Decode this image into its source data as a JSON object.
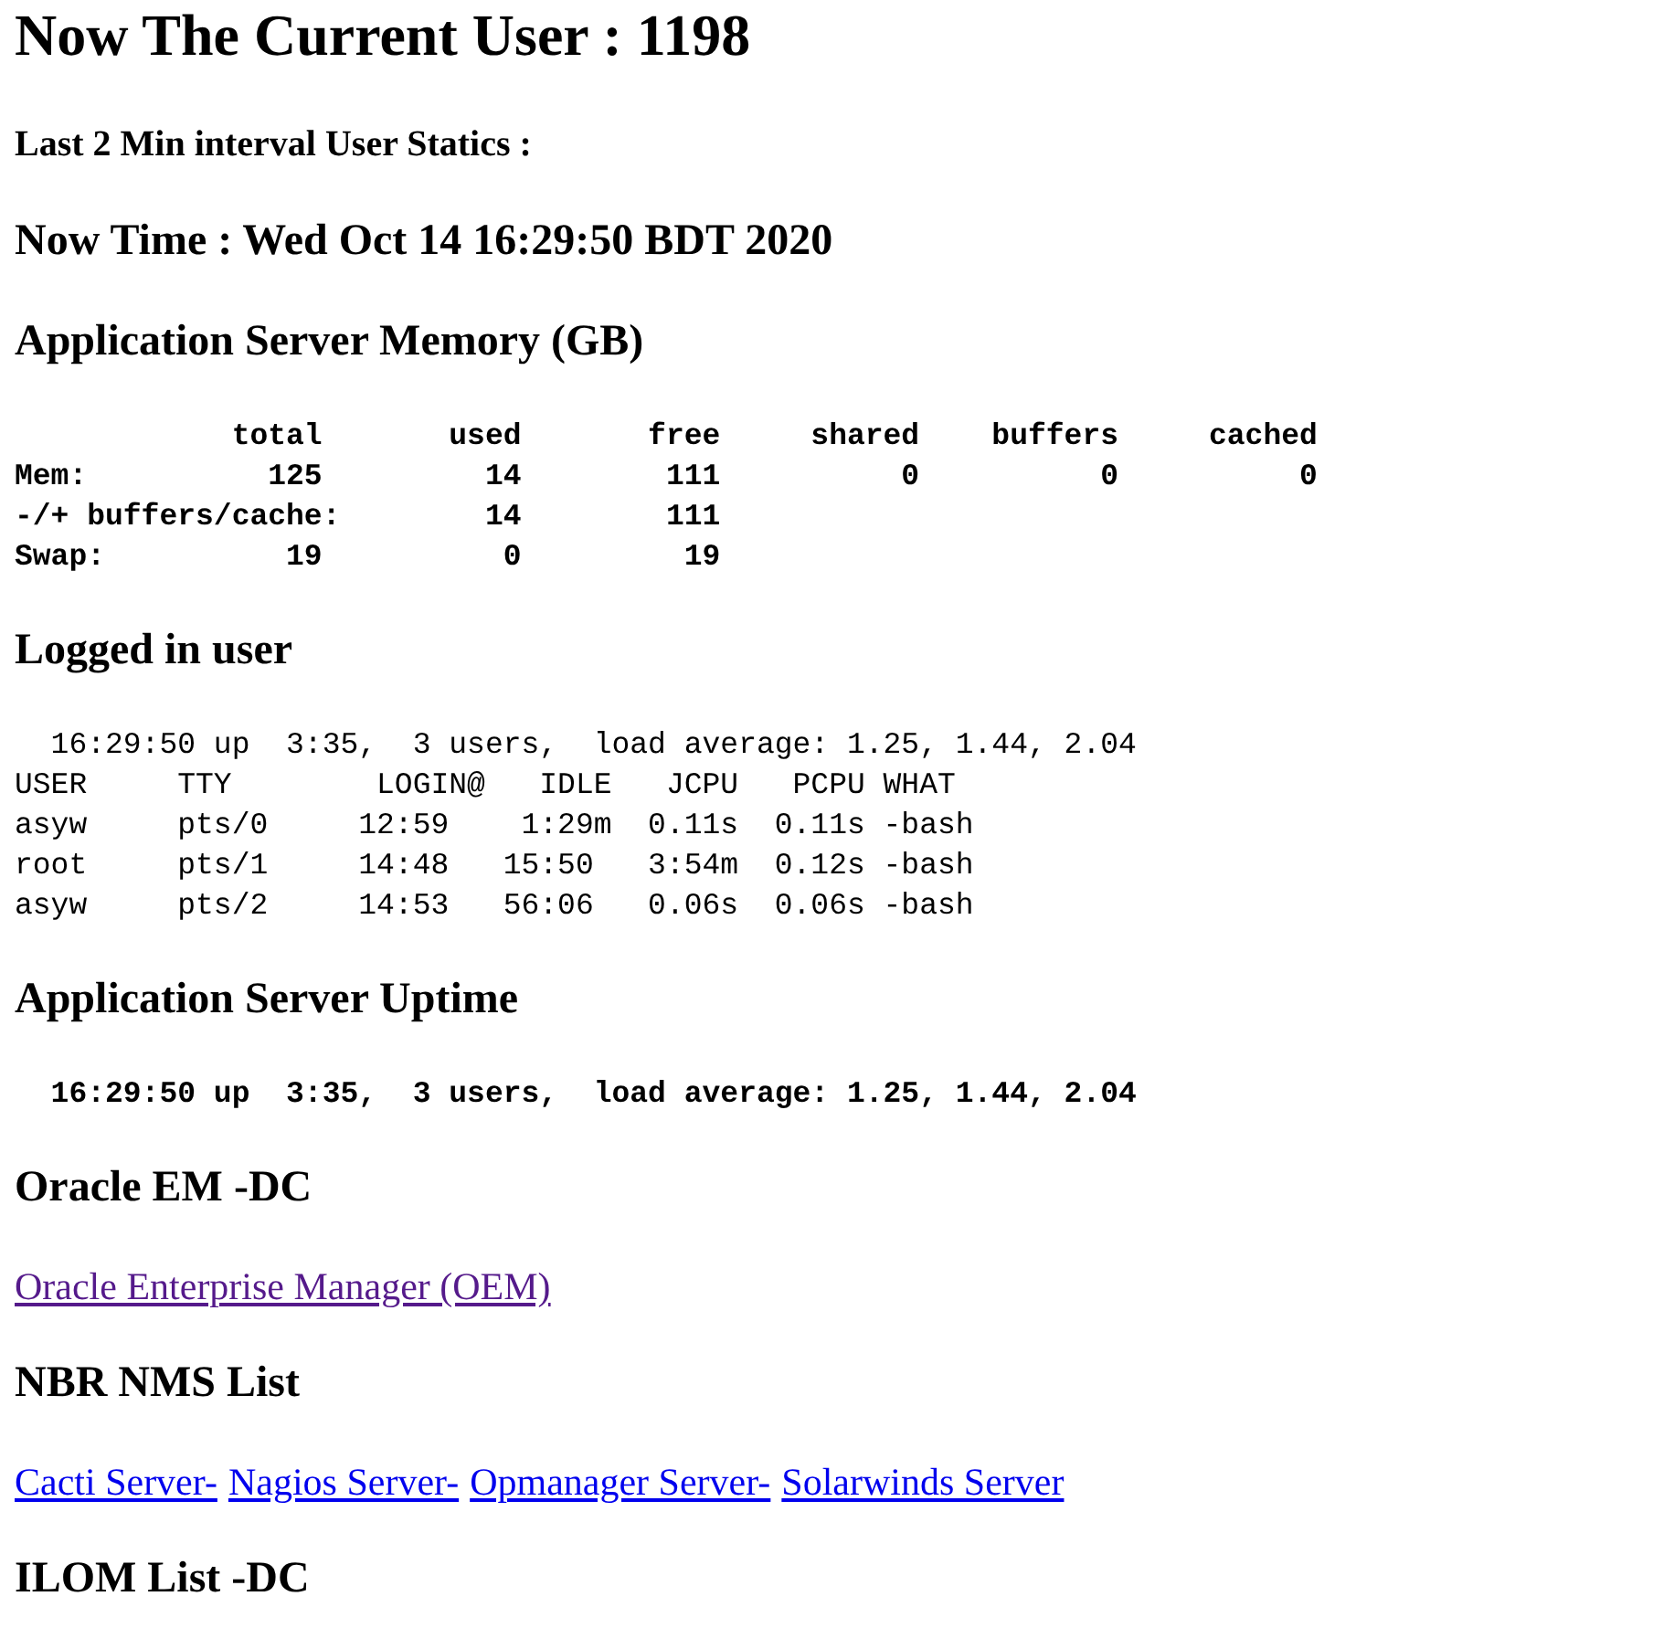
{
  "title": "Now The Current User : 1198",
  "interval_label": "Last 2 Min interval User Statics :",
  "now_time": "Now Time : Wed Oct 14 16:29:50 BDT 2020",
  "sections": [
    {
      "heading": "Application Server Memory (GB)",
      "kind": "console",
      "bold": true,
      "lines": [
        "            total       used       free     shared    buffers     cached",
        "Mem:          125         14        111          0          0          0",
        "-/+ buffers/cache:        14        111",
        "Swap:          19          0         19"
      ]
    },
    {
      "heading": "Logged in user",
      "kind": "console",
      "bold": false,
      "lines": [
        "  16:29:50 up  3:35,  3 users,  load average: 1.25, 1.44, 2.04",
        "USER     TTY        LOGIN@   IDLE   JCPU   PCPU WHAT",
        "asyw     pts/0     12:59    1:29m  0.11s  0.11s -bash",
        "root     pts/1     14:48   15:50   3:54m  0.12s -bash",
        "asyw     pts/2     14:53   56:06   0.06s  0.06s -bash"
      ]
    },
    {
      "heading": "Application Server Uptime",
      "kind": "console",
      "bold": true,
      "lines": [
        "  16:29:50 up  3:35,  3 users,  load average: 1.25, 1.44, 2.04"
      ]
    },
    {
      "heading": "Oracle EM -DC",
      "kind": "links",
      "links": [
        {
          "text": "Oracle Enterprise Manager (OEM)",
          "visited": true
        }
      ]
    },
    {
      "heading": "NBR NMS List",
      "kind": "links",
      "links": [
        {
          "text": "Cacti Server-",
          "visited": false
        },
        {
          "text": "Nagios Server-",
          "visited": false
        },
        {
          "text": "Opmanager Server-",
          "visited": false
        },
        {
          "text": "Solarwinds Server",
          "visited": false
        }
      ]
    },
    {
      "heading": "ILOM List -DC",
      "kind": "none"
    }
  ]
}
